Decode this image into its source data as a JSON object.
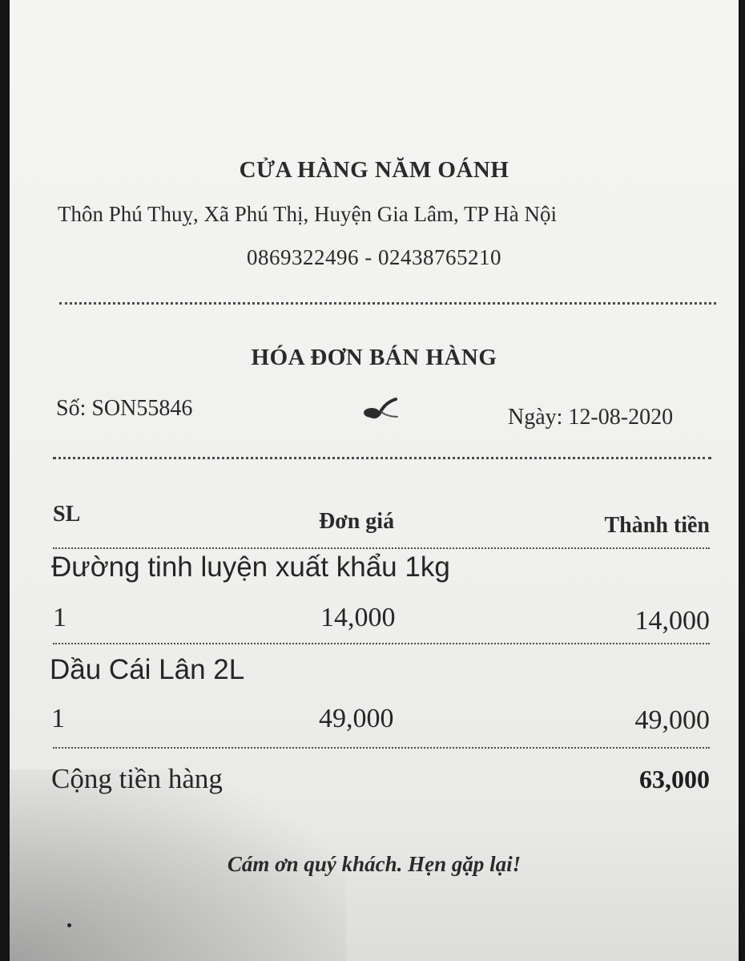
{
  "store": {
    "name": "CỬA HÀNG NĂM OÁNH",
    "address": "Thôn Phú Thuỵ, Xã Phú Thị, Huyện Gia Lâm, TP Hà Nội",
    "phone": "0869322496 - 02438765210"
  },
  "invoice": {
    "title": "HÓA ĐƠN BÁN HÀNG",
    "number_label": "Số: SON55846",
    "date_label": "Ngày: 12-08-2020"
  },
  "table": {
    "headers": {
      "qty": "SL",
      "unit_price": "Đơn giá",
      "amount": "Thành tiền"
    },
    "items": [
      {
        "name": "Đường tinh luyện xuất khẩu 1kg",
        "qty": "1",
        "unit_price": "14,000",
        "amount": "14,000"
      },
      {
        "name": "Dầu Cái Lân 2L",
        "qty": "1",
        "unit_price": "49,000",
        "amount": "49,000"
      }
    ]
  },
  "total": {
    "label": "Cộng tiền hàng",
    "value": "63,000"
  },
  "footer": {
    "thanks": "Cám ơn quý khách. Hẹn gặp lại!"
  },
  "colors": {
    "paper": "#f1f1ef",
    "ink": "#2a2a2a",
    "background": "#151515"
  }
}
